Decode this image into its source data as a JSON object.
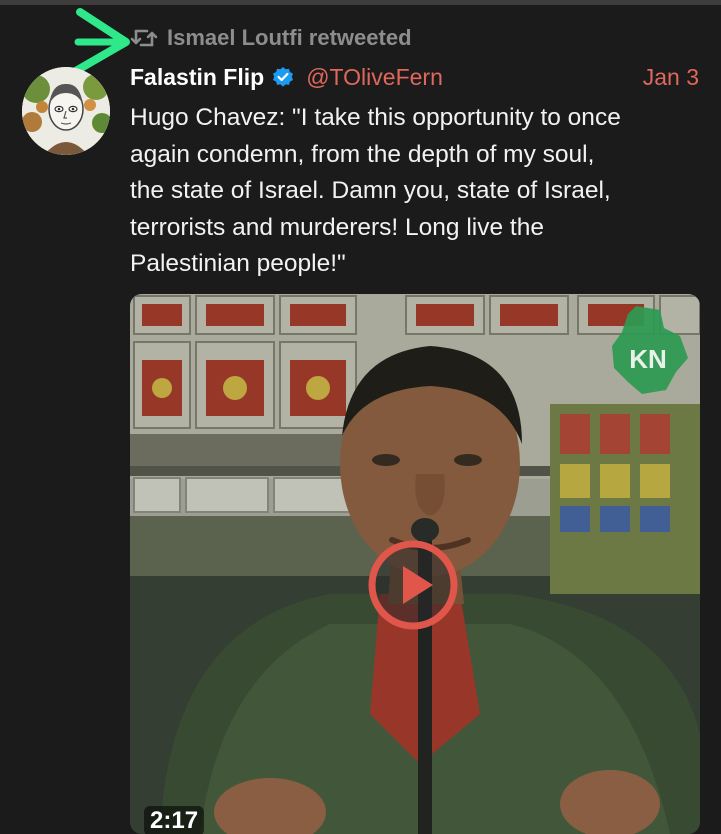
{
  "retweet": {
    "icon": "retweet-icon",
    "text": "Ismael Loutfi retweeted"
  },
  "tweet": {
    "display_name": "Falastin Flip",
    "verified": true,
    "handle": "@TOliveFern",
    "date": "Jan 3",
    "text": "Hugo Chavez: \"I take this opportunity to once\nagain condemn, from the depth of my soul,\nthe state of Israel. Damn you, state of Israel,\nterrorists and murderers! Long live the\nPalestinian people!\""
  },
  "media": {
    "type": "video",
    "duration": "2:17",
    "watermark": "KN"
  },
  "colors": {
    "background": "#1b1b1b",
    "accent": "#e0675c",
    "muted": "#8d8d8d",
    "verified": "#1d9bf0",
    "annotation_arrow": "#2ee88a"
  }
}
